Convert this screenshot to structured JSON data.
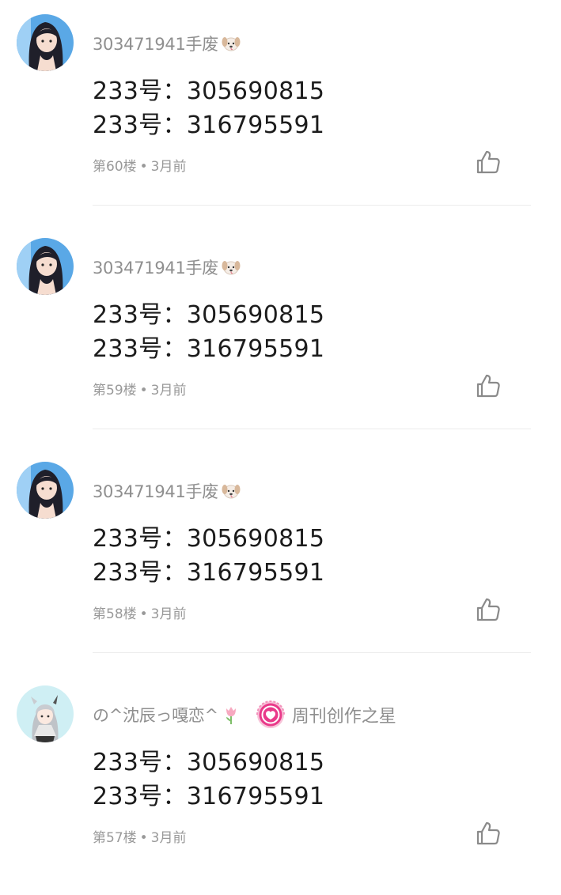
{
  "comments": [
    {
      "username": "303471941手废",
      "emoji_icon": "puppy-face-emoji",
      "badge": "",
      "lines": [
        "233号：305690815",
        "233号：316795591"
      ],
      "floor": "第60楼",
      "separator": "•",
      "time": "3月前"
    },
    {
      "username": "303471941手废",
      "emoji_icon": "puppy-face-emoji",
      "badge": "",
      "lines": [
        "233号：305690815",
        "233号：316795591"
      ],
      "floor": "第59楼",
      "separator": "•",
      "time": "3月前"
    },
    {
      "username": "303471941手废",
      "emoji_icon": "puppy-face-emoji",
      "badge": "",
      "lines": [
        "233号：305690815",
        "233号：316795591"
      ],
      "floor": "第58楼",
      "separator": "•",
      "time": "3月前"
    },
    {
      "username": "の^沈辰っ嘎恋^",
      "emoji_icon": "tulip-emoji",
      "badge": "周刊创作之星",
      "badge_icon": "weekly-creator-star-badge-icon",
      "lines": [
        "233号：305690815",
        "233号：316795591"
      ],
      "floor": "第57楼",
      "separator": "•",
      "time": "3月前"
    }
  ],
  "colors": {
    "username": "#8f8f8f",
    "meta": "#999999",
    "content": "#1c1c1c",
    "divider": "#ececec",
    "badge_pink": "#e93a8a"
  }
}
